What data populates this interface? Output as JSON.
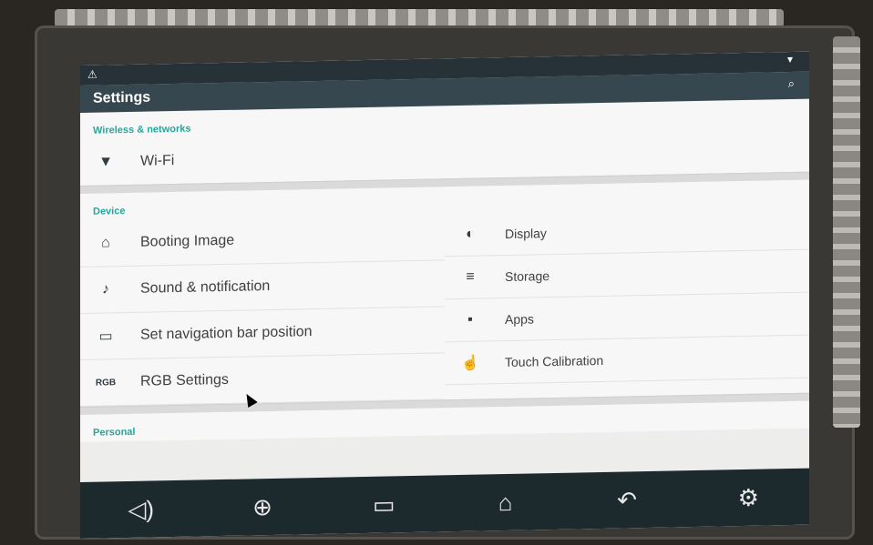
{
  "statusbar": {
    "warn_icon": "⚠",
    "wifi_icon": "▾"
  },
  "actionbar": {
    "title": "Settings",
    "search_icon": "⌕"
  },
  "sections": {
    "wireless": {
      "header": "Wireless & networks",
      "items": [
        {
          "label": "Wi-Fi",
          "icon": "wifi-icon",
          "glyph": "▼"
        }
      ]
    },
    "device": {
      "header": "Device",
      "left": [
        {
          "label": "Booting Image",
          "icon": "home-icon",
          "glyph": "⌂"
        },
        {
          "label": "Sound & notification",
          "icon": "bell-icon",
          "glyph": "♪"
        },
        {
          "label": "Set navigation bar position",
          "icon": "navbar-position-icon",
          "glyph": "▭"
        },
        {
          "label": "RGB Settings",
          "icon": "rgb-icon",
          "glyph": "RGB"
        }
      ],
      "right": [
        {
          "label": "Display",
          "icon": "display-icon",
          "glyph": "◐"
        },
        {
          "label": "Storage",
          "icon": "storage-icon",
          "glyph": "≡"
        },
        {
          "label": "Apps",
          "icon": "apps-icon",
          "glyph": "▪"
        },
        {
          "label": "Touch Calibration",
          "icon": "touch-icon",
          "glyph": "☝"
        }
      ]
    },
    "personal": {
      "header": "Personal"
    }
  },
  "navbar": {
    "volume": "◁)",
    "target": "⊕",
    "recents": "▭",
    "home": "⌂",
    "back": "↶",
    "settings": "⚙"
  },
  "colors": {
    "accent": "#26a69a",
    "actionbar": "#37474f",
    "statusbar": "#263238",
    "navbar": "#1c2a2d"
  }
}
